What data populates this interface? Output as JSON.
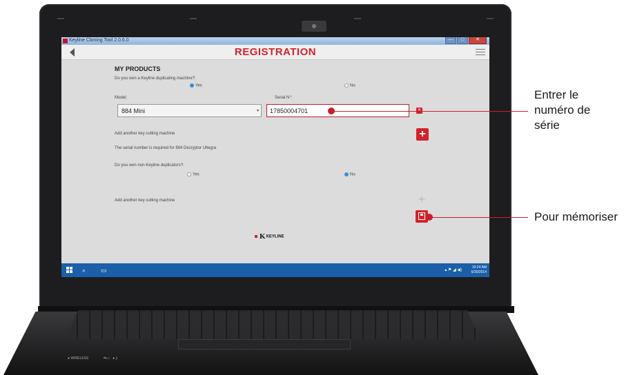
{
  "window": {
    "title": "Keyline Cloning Tool 2.0.6.0",
    "controls": [
      "—",
      "□",
      "✕"
    ]
  },
  "header": {
    "title": "REGISTRATION",
    "back_icon": "back-arrow-icon",
    "menu_icon": "hamburger-menu-icon"
  },
  "my_products": {
    "section_title": "MY PRODUCTS",
    "question_keyline": "Do you own a Keyline duplicating machine?:",
    "keyline_yes": "Yes",
    "keyline_no": "No",
    "keyline_selected": "Yes",
    "model_label": "Model:",
    "model_value": "884 Mini",
    "serial_label": "Serial N°:",
    "serial_value": "17850004701",
    "add_machine_1": "Add another key cutting machine",
    "serial_required_note": "The serial number is required for 884 Decryptor Ultegra",
    "question_other": "Do you own non-Keyline duplicators?:",
    "other_yes": "Yes",
    "other_no": "No",
    "other_selected": "No",
    "add_machine_2": "Add another key cutting machine",
    "brand_logo_text": "KEYLINE"
  },
  "taskbar": {
    "time": "10:24 AM",
    "date": "6/30/2014"
  },
  "laptop": {
    "wireless_label": "WIRELESS"
  },
  "callouts": {
    "serial": [
      "Entrer le",
      "numéro de",
      "série"
    ],
    "save": "Pour mémoriser"
  },
  "colors": {
    "accent": "#d2232a",
    "taskbar": "#1b5fa8",
    "screen_bg": "#dcdcdc"
  }
}
